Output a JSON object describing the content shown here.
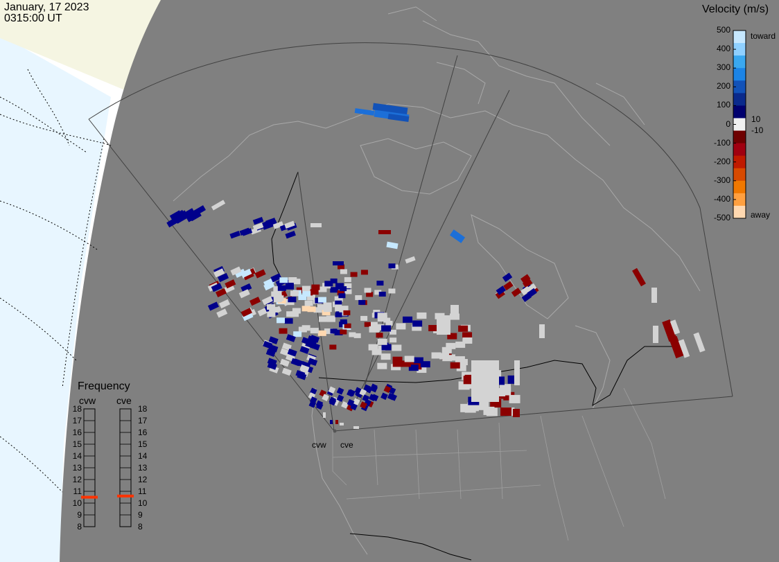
{
  "header": {
    "date": "January, 17 2023",
    "time": "0315:00 UT"
  },
  "colorbar": {
    "title": "Velocity (m/s)",
    "ticks": [
      "500",
      "400",
      "300",
      "200",
      "100",
      "0",
      "-100",
      "-200",
      "-300",
      "-400",
      "-500"
    ],
    "label_toward": "toward",
    "label_away": "away",
    "label_pos": "10",
    "label_neg": "-10",
    "colors": [
      "#c6e8ff",
      "#8fd0ff",
      "#3aa8f0",
      "#1c84e6",
      "#1252b8",
      "#0a2a8c",
      "#00006e",
      "#f0f0f0",
      "#6e0000",
      "#a00010",
      "#c01a00",
      "#d84a00",
      "#f07800",
      "#ffa040",
      "#ffd8b0"
    ]
  },
  "frequency": {
    "title": "Frequency",
    "left_label": "cvw",
    "right_label": "cve",
    "scale": [
      "18",
      "17",
      "16",
      "15",
      "14",
      "13",
      "12",
      "11",
      "10",
      "9",
      "8"
    ],
    "cvw_mhz": 10.5,
    "cve_mhz": 10.6,
    "marker_color": "#ff3300"
  },
  "sites": {
    "west": "cvw",
    "east": "cve"
  },
  "map_colors": {
    "land": "#808080",
    "ocean": "#e8f6ff",
    "ice": "#f5f5e2",
    "coast": "#a8a8a8",
    "border": "#000000",
    "gs_scatter": "#d3d3d3"
  }
}
